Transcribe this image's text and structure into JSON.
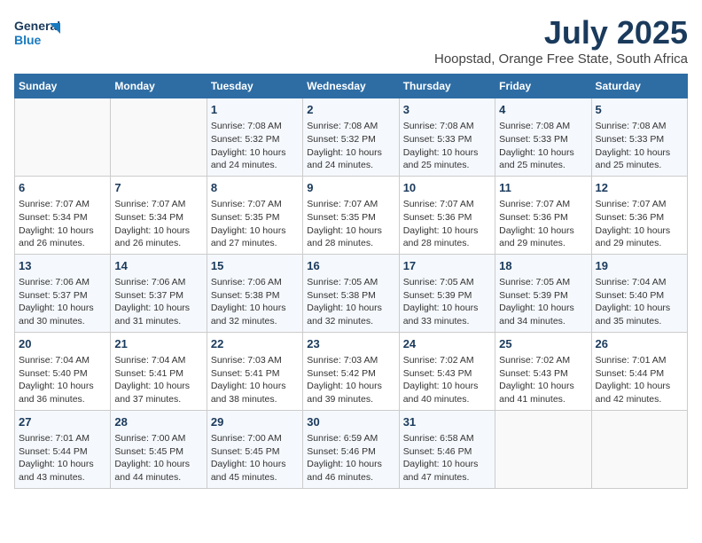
{
  "logo": {
    "line1": "General",
    "line2": "Blue"
  },
  "title": "July 2025",
  "subtitle": "Hoopstad, Orange Free State, South Africa",
  "weekdays": [
    "Sunday",
    "Monday",
    "Tuesday",
    "Wednesday",
    "Thursday",
    "Friday",
    "Saturday"
  ],
  "weeks": [
    [
      {
        "day": "",
        "detail": ""
      },
      {
        "day": "",
        "detail": ""
      },
      {
        "day": "1",
        "detail": "Sunrise: 7:08 AM\nSunset: 5:32 PM\nDaylight: 10 hours and 24 minutes."
      },
      {
        "day": "2",
        "detail": "Sunrise: 7:08 AM\nSunset: 5:32 PM\nDaylight: 10 hours and 24 minutes."
      },
      {
        "day": "3",
        "detail": "Sunrise: 7:08 AM\nSunset: 5:33 PM\nDaylight: 10 hours and 25 minutes."
      },
      {
        "day": "4",
        "detail": "Sunrise: 7:08 AM\nSunset: 5:33 PM\nDaylight: 10 hours and 25 minutes."
      },
      {
        "day": "5",
        "detail": "Sunrise: 7:08 AM\nSunset: 5:33 PM\nDaylight: 10 hours and 25 minutes."
      }
    ],
    [
      {
        "day": "6",
        "detail": "Sunrise: 7:07 AM\nSunset: 5:34 PM\nDaylight: 10 hours and 26 minutes."
      },
      {
        "day": "7",
        "detail": "Sunrise: 7:07 AM\nSunset: 5:34 PM\nDaylight: 10 hours and 26 minutes."
      },
      {
        "day": "8",
        "detail": "Sunrise: 7:07 AM\nSunset: 5:35 PM\nDaylight: 10 hours and 27 minutes."
      },
      {
        "day": "9",
        "detail": "Sunrise: 7:07 AM\nSunset: 5:35 PM\nDaylight: 10 hours and 28 minutes."
      },
      {
        "day": "10",
        "detail": "Sunrise: 7:07 AM\nSunset: 5:36 PM\nDaylight: 10 hours and 28 minutes."
      },
      {
        "day": "11",
        "detail": "Sunrise: 7:07 AM\nSunset: 5:36 PM\nDaylight: 10 hours and 29 minutes."
      },
      {
        "day": "12",
        "detail": "Sunrise: 7:07 AM\nSunset: 5:36 PM\nDaylight: 10 hours and 29 minutes."
      }
    ],
    [
      {
        "day": "13",
        "detail": "Sunrise: 7:06 AM\nSunset: 5:37 PM\nDaylight: 10 hours and 30 minutes."
      },
      {
        "day": "14",
        "detail": "Sunrise: 7:06 AM\nSunset: 5:37 PM\nDaylight: 10 hours and 31 minutes."
      },
      {
        "day": "15",
        "detail": "Sunrise: 7:06 AM\nSunset: 5:38 PM\nDaylight: 10 hours and 32 minutes."
      },
      {
        "day": "16",
        "detail": "Sunrise: 7:05 AM\nSunset: 5:38 PM\nDaylight: 10 hours and 32 minutes."
      },
      {
        "day": "17",
        "detail": "Sunrise: 7:05 AM\nSunset: 5:39 PM\nDaylight: 10 hours and 33 minutes."
      },
      {
        "day": "18",
        "detail": "Sunrise: 7:05 AM\nSunset: 5:39 PM\nDaylight: 10 hours and 34 minutes."
      },
      {
        "day": "19",
        "detail": "Sunrise: 7:04 AM\nSunset: 5:40 PM\nDaylight: 10 hours and 35 minutes."
      }
    ],
    [
      {
        "day": "20",
        "detail": "Sunrise: 7:04 AM\nSunset: 5:40 PM\nDaylight: 10 hours and 36 minutes."
      },
      {
        "day": "21",
        "detail": "Sunrise: 7:04 AM\nSunset: 5:41 PM\nDaylight: 10 hours and 37 minutes."
      },
      {
        "day": "22",
        "detail": "Sunrise: 7:03 AM\nSunset: 5:41 PM\nDaylight: 10 hours and 38 minutes."
      },
      {
        "day": "23",
        "detail": "Sunrise: 7:03 AM\nSunset: 5:42 PM\nDaylight: 10 hours and 39 minutes."
      },
      {
        "day": "24",
        "detail": "Sunrise: 7:02 AM\nSunset: 5:43 PM\nDaylight: 10 hours and 40 minutes."
      },
      {
        "day": "25",
        "detail": "Sunrise: 7:02 AM\nSunset: 5:43 PM\nDaylight: 10 hours and 41 minutes."
      },
      {
        "day": "26",
        "detail": "Sunrise: 7:01 AM\nSunset: 5:44 PM\nDaylight: 10 hours and 42 minutes."
      }
    ],
    [
      {
        "day": "27",
        "detail": "Sunrise: 7:01 AM\nSunset: 5:44 PM\nDaylight: 10 hours and 43 minutes."
      },
      {
        "day": "28",
        "detail": "Sunrise: 7:00 AM\nSunset: 5:45 PM\nDaylight: 10 hours and 44 minutes."
      },
      {
        "day": "29",
        "detail": "Sunrise: 7:00 AM\nSunset: 5:45 PM\nDaylight: 10 hours and 45 minutes."
      },
      {
        "day": "30",
        "detail": "Sunrise: 6:59 AM\nSunset: 5:46 PM\nDaylight: 10 hours and 46 minutes."
      },
      {
        "day": "31",
        "detail": "Sunrise: 6:58 AM\nSunset: 5:46 PM\nDaylight: 10 hours and 47 minutes."
      },
      {
        "day": "",
        "detail": ""
      },
      {
        "day": "",
        "detail": ""
      }
    ]
  ]
}
